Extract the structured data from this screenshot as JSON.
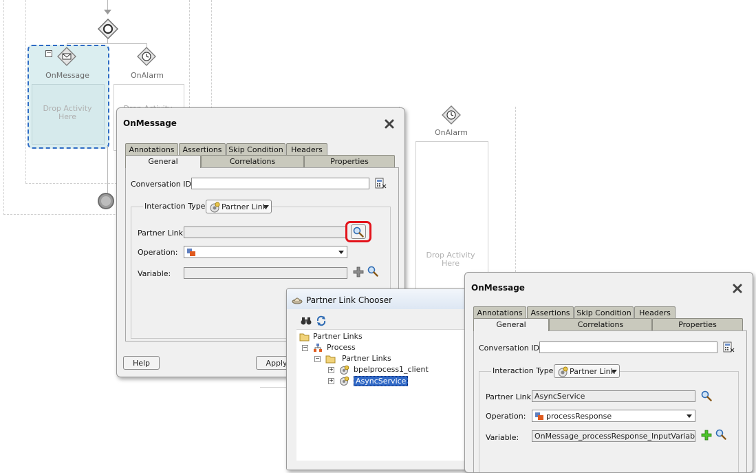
{
  "canvas": {
    "onmessage_label": "OnMessage",
    "onalarm_label": "OnAlarm",
    "onalarm2_label": "OnAlarm",
    "drop_activity_text": "Drop Activity\nHere",
    "drop_activity_partial": "Drop Activity",
    "drop_activity_text2": "Drop Activity\nHere"
  },
  "dialog1": {
    "title": "OnMessage",
    "tabs_top": [
      "Annotations",
      "Assertions",
      "Skip Condition",
      "Headers"
    ],
    "tabs_bottom": [
      "General",
      "Correlations",
      "Properties"
    ],
    "conversation_id_label": "Conversation ID:",
    "conversation_id_value": "",
    "interaction_type_label": "Interaction Type:",
    "interaction_type_value": "Partner Link",
    "partner_link_label": "Partner Link:",
    "partner_link_value": "",
    "operation_label": "Operation:",
    "operation_value": "",
    "variable_label": "Variable:",
    "variable_value": "",
    "help_button": "Help",
    "apply_button": "Apply"
  },
  "chooser": {
    "title": "Partner Link Chooser",
    "tree": {
      "root": "Partner Links",
      "process": "Process",
      "partner_links": "Partner Links",
      "item1": "bpelprocess1_client",
      "item2": "AsyncService"
    }
  },
  "dialog2": {
    "title": "OnMessage",
    "tabs_top": [
      "Annotations",
      "Assertions",
      "Skip Condition",
      "Headers"
    ],
    "tabs_bottom": [
      "General",
      "Correlations",
      "Properties"
    ],
    "conversation_id_label": "Conversation ID:",
    "conversation_id_value": "",
    "interaction_type_label": "Interaction Type:",
    "interaction_type_value": "Partner Link",
    "partner_link_label": "Partner Link:",
    "partner_link_value": "AsyncService",
    "operation_label": "Operation:",
    "operation_value": "processResponse",
    "variable_label": "Variable:",
    "variable_value": "OnMessage_processResponse_InputVariable"
  },
  "colors": {
    "highlight_ring": "#e3131b",
    "selected_activity": "#dbeef0",
    "selection_border": "#2d6bc4"
  }
}
